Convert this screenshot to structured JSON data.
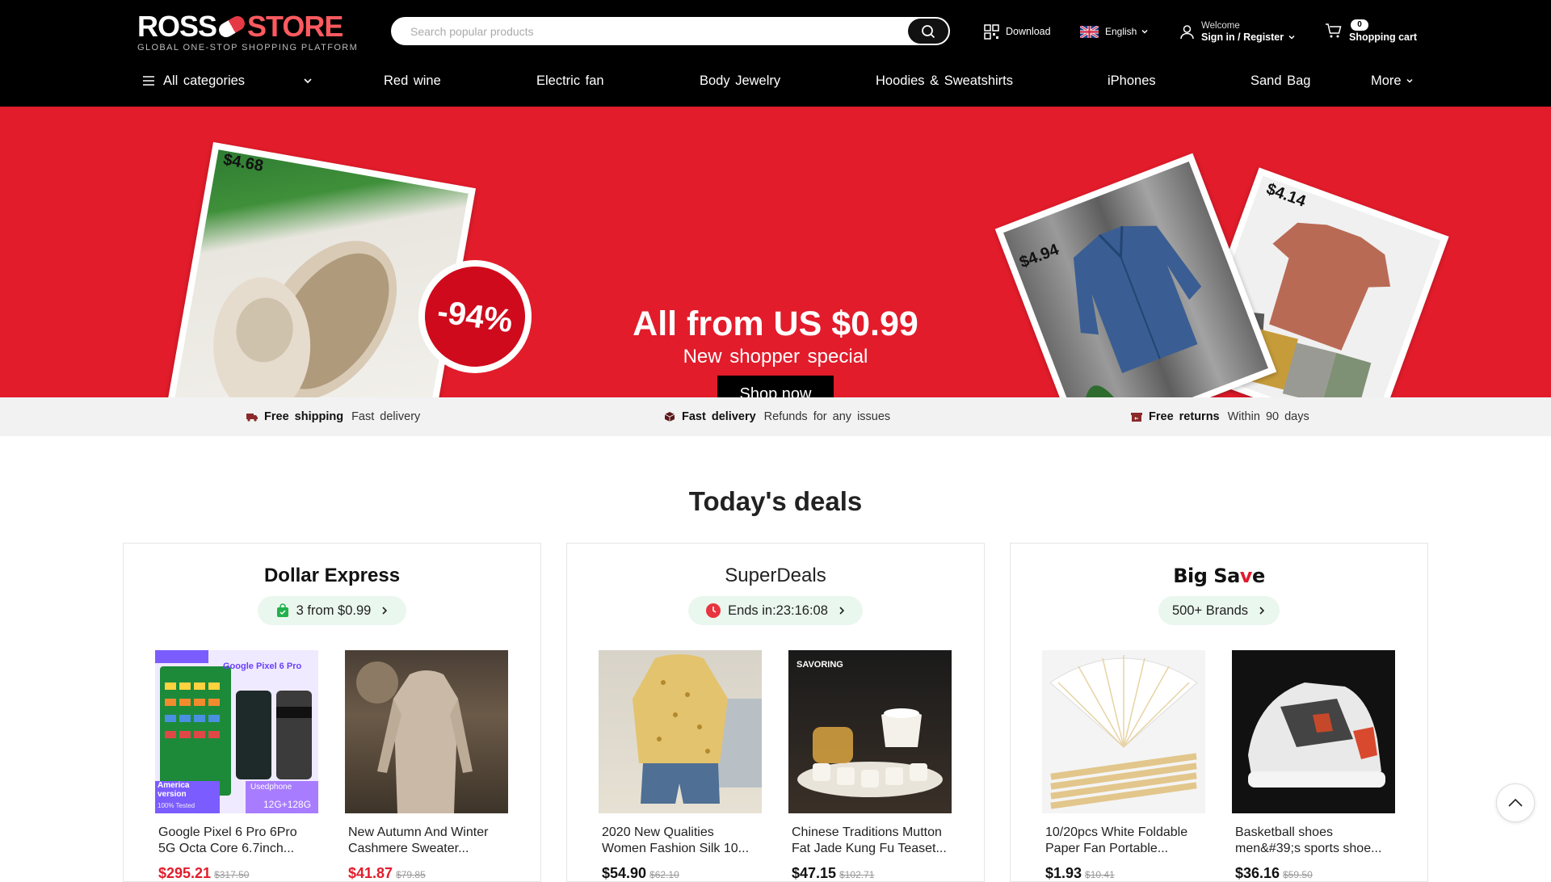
{
  "header": {
    "logo_text_a": "ROSS",
    "logo_text_b": "STORE",
    "logo_tagline": "GLOBAL ONE-STOP SHOPPING PLATFORM",
    "search_placeholder": "Search popular products",
    "download_label": "Download",
    "language_label": "English",
    "welcome_label": "Welcome",
    "signin_label": "Sign in / Register",
    "cart_count": "0",
    "cart_label": "Shopping cart"
  },
  "nav": {
    "all_categories": "All categories",
    "categories": [
      "Red wine",
      "Electric fan",
      "Body Jewelry",
      "Hoodies & Sweatshirts",
      "iPhones",
      "Sand Bag"
    ],
    "more": "More"
  },
  "banner": {
    "title": "All from US $0.99",
    "subtitle": "New shopper special",
    "button": "Shop now",
    "discount": "-94%",
    "price_tags": [
      "$4.68",
      "$4.94",
      "$4.14"
    ]
  },
  "benefits": [
    {
      "title": "Free shipping",
      "text": "Fast delivery"
    },
    {
      "title": "Fast delivery",
      "text": "Refunds for any issues"
    },
    {
      "title": "Free returns",
      "text": "Within 90 days"
    }
  ],
  "deals": {
    "title": "Today's deals",
    "cards": [
      {
        "title": "Dollar Express",
        "pill": "3 from $0.99",
        "products": [
          {
            "name": "Google Pixel 6 Pro 6Pro 5G Octa Core 6.7inch...",
            "price": "$295.21",
            "old": "$317.50"
          },
          {
            "name": "New Autumn And Winter Cashmere Sweater...",
            "price": "$41.87",
            "old": "$79.85"
          }
        ]
      },
      {
        "title": "SuperDeals",
        "pill": "Ends in:23:16:08",
        "products": [
          {
            "name": "2020 New Qualities Women Fashion Silk 10...",
            "price": "$54.90",
            "old": "$62.10"
          },
          {
            "name": "Chinese Traditions Mutton Fat Jade Kung Fu Teaset...",
            "price": "$47.15",
            "old": "$102.71"
          }
        ]
      },
      {
        "title_a": "Big Sa",
        "title_b": "v",
        "title_c": "e",
        "pill": "500+ Brands",
        "products": [
          {
            "name": "10/20pcs White Foldable Paper Fan Portable...",
            "price": "$1.93",
            "old": "$10.41"
          },
          {
            "name": "Basketball shoes men&#39;s sports shoe...",
            "price": "$36.16",
            "old": "$59.50"
          }
        ]
      }
    ]
  },
  "product_overlay": {
    "pixel_brand": "Google Pixel 6 Pro",
    "pixel_version": "America version",
    "pixel_tested": "100% Tested",
    "pixel_used": "Usedphone",
    "pixel_storage": "12G+128G",
    "teaset_brand": "SAVORING"
  },
  "colors": {
    "brand_red": "#e21c2b",
    "pill_bg": "#eaf7ee",
    "header_bg": "#000000"
  }
}
